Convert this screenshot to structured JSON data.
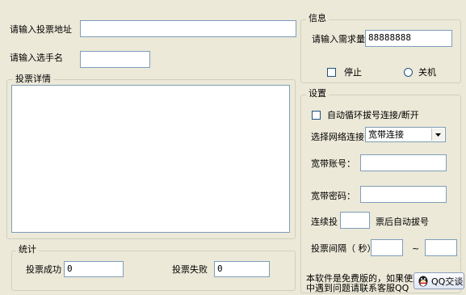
{
  "left": {
    "url_label": "请输入投票地址",
    "url_value": "",
    "name_label": "请输入选手名",
    "name_value": "",
    "details_title": "投票详情",
    "details_value": ""
  },
  "stats": {
    "title": "统计",
    "success_label": "投票成功",
    "success_value": "0",
    "fail_label": "投票失败",
    "fail_value": "0"
  },
  "info": {
    "title": "信息",
    "demand_label": "请输入需求量",
    "demand_value": "88888888",
    "stop_label": "停止",
    "shutdown_label": "关机"
  },
  "settings": {
    "title": "设置",
    "auto_dial_label": "自动循环拔号连接/断开",
    "network_label": "选择网络连接",
    "network_selected": "宽带连接",
    "account_label": "宽带账号：",
    "account_value": "",
    "password_label": "宽带密码：",
    "password_value": "",
    "continuous_label": "连续投",
    "continuous_value": "",
    "after_dial_label": "票后自动拔号",
    "interval_label": "投票间隔（ 秒）",
    "interval_from": "",
    "interval_sep": "~",
    "interval_to": ""
  },
  "footer": {
    "notice_line1": "本软件是免费版的，如果使用",
    "notice_line2": "中遇到问题请联系客服QQ",
    "qq_button": "QQ交谈"
  }
}
